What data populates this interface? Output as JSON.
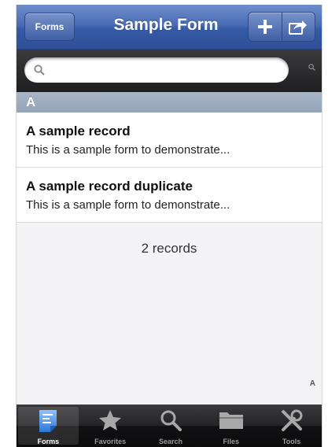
{
  "navbar": {
    "back_label": "Forms",
    "title": "Sample Form",
    "add_icon": "plus-icon",
    "share_icon": "share-icon"
  },
  "search": {
    "placeholder": "",
    "value": ""
  },
  "section": {
    "letter": "A"
  },
  "records": [
    {
      "title": "A sample record",
      "subtitle": "This is a sample form to demonstrate..."
    },
    {
      "title": "A sample record duplicate",
      "subtitle": "This is a sample form to demonstrate..."
    }
  ],
  "records_count": "2 records",
  "index": {
    "letter": "A"
  },
  "tabbar": {
    "selected": "Forms",
    "tabs": [
      {
        "label": "Forms",
        "icon": "forms-icon"
      },
      {
        "label": "Favorites",
        "icon": "star-icon"
      },
      {
        "label": "Search",
        "icon": "search-icon"
      },
      {
        "label": "Files",
        "icon": "folder-icon"
      },
      {
        "label": "Tools",
        "icon": "tools-icon"
      }
    ]
  },
  "colors": {
    "navbar": "#355aa6",
    "section_header": "#9eadbf",
    "tabbar": "#1a1a1c",
    "selected_tab_icon": "#4a90e2"
  }
}
